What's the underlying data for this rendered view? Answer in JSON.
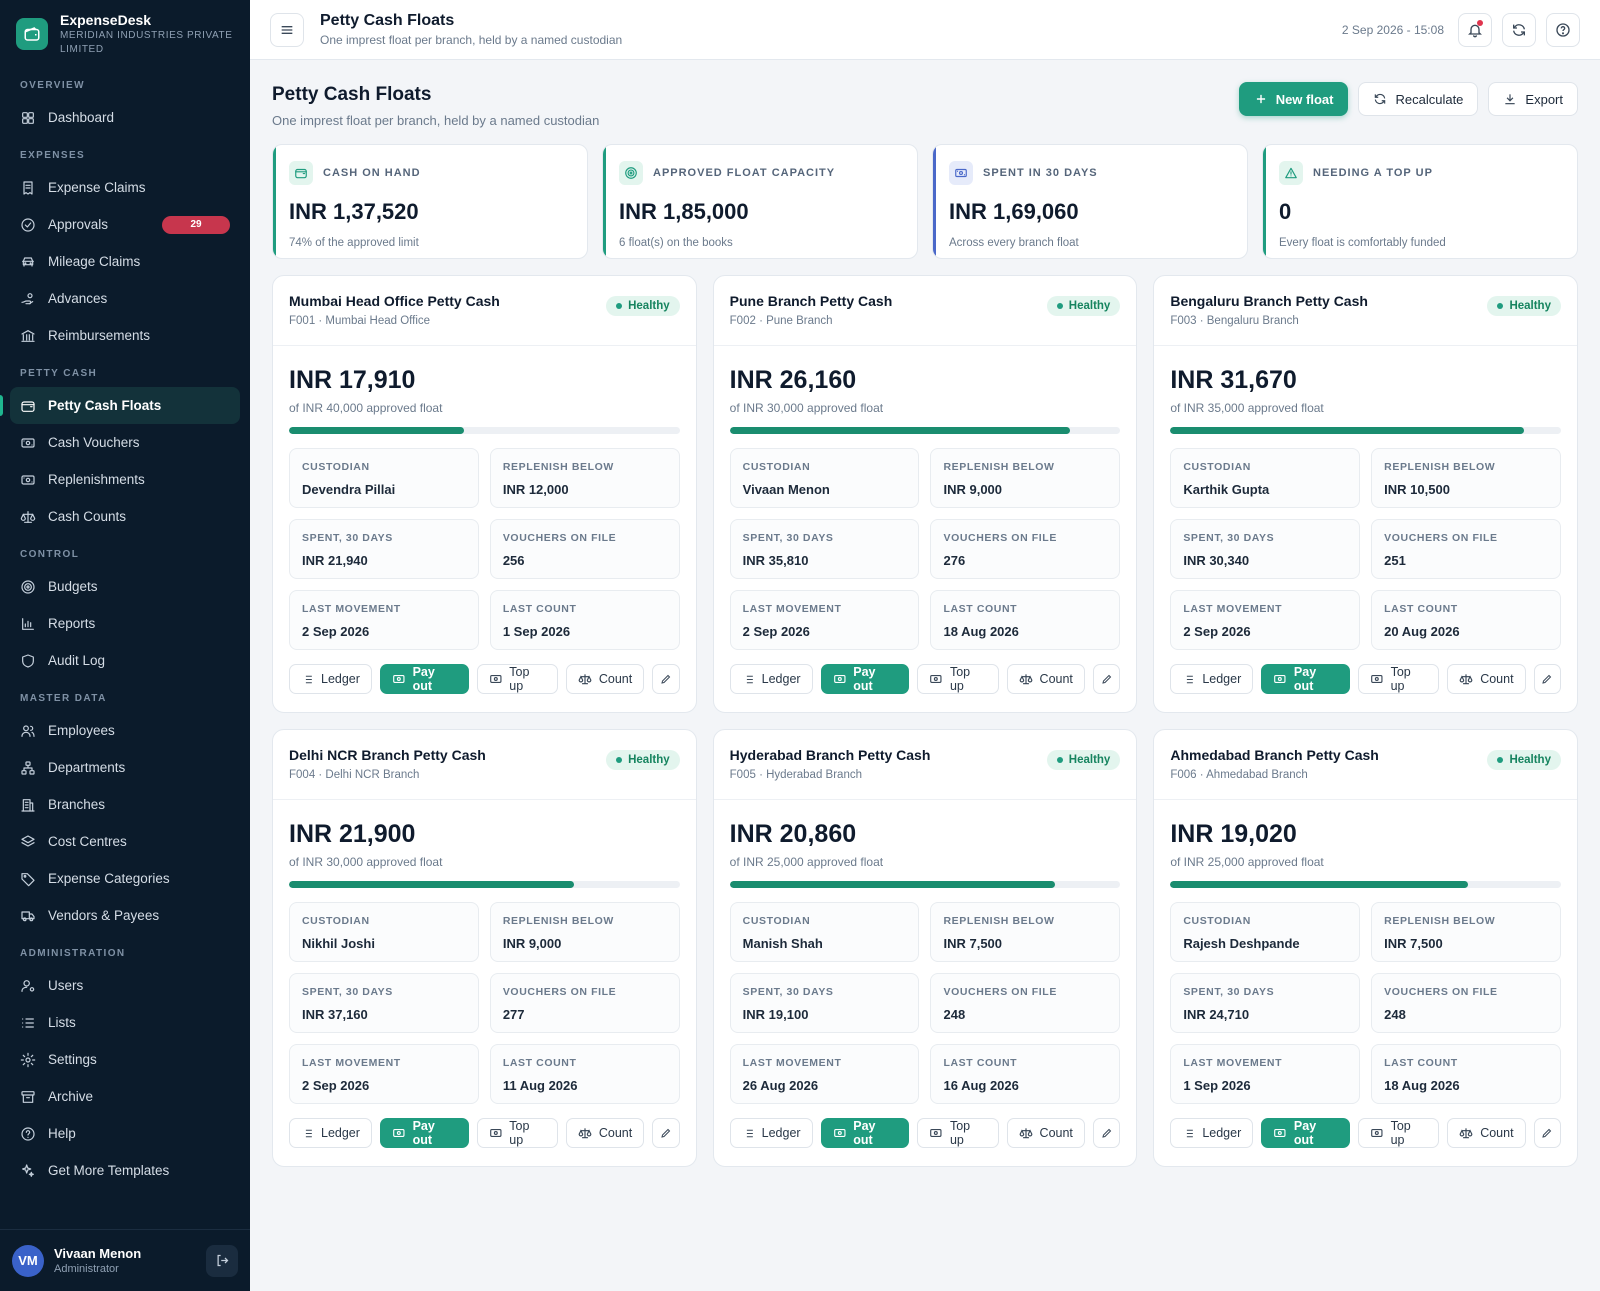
{
  "brand": {
    "name": "ExpenseDesk",
    "org": "MERIDIAN INDUSTRIES PRIVATE LIMITED",
    "accent": "#1f9c7f"
  },
  "nav": {
    "sections": [
      {
        "title": "OVERVIEW",
        "items": [
          {
            "label": "Dashboard",
            "icon": "dashboard-icon"
          }
        ]
      },
      {
        "title": "EXPENSES",
        "items": [
          {
            "label": "Expense Claims",
            "icon": "receipt-icon"
          },
          {
            "label": "Approvals",
            "icon": "check-circle-icon",
            "badge": "29"
          },
          {
            "label": "Mileage Claims",
            "icon": "car-icon"
          },
          {
            "label": "Advances",
            "icon": "hand-coin-icon"
          },
          {
            "label": "Reimbursements",
            "icon": "bank-icon"
          }
        ]
      },
      {
        "title": "PETTY CASH",
        "items": [
          {
            "label": "Petty Cash Floats",
            "icon": "wallet-icon",
            "active": true
          },
          {
            "label": "Cash Vouchers",
            "icon": "banknote-icon"
          },
          {
            "label": "Replenishments",
            "icon": "banknote-icon"
          },
          {
            "label": "Cash Counts",
            "icon": "scale-icon"
          }
        ]
      },
      {
        "title": "CONTROL",
        "items": [
          {
            "label": "Budgets",
            "icon": "target-icon"
          },
          {
            "label": "Reports",
            "icon": "bar-chart-icon"
          },
          {
            "label": "Audit Log",
            "icon": "shield-icon"
          }
        ]
      },
      {
        "title": "MASTER DATA",
        "items": [
          {
            "label": "Employees",
            "icon": "users-icon"
          },
          {
            "label": "Departments",
            "icon": "org-chart-icon"
          },
          {
            "label": "Branches",
            "icon": "building-icon"
          },
          {
            "label": "Cost Centres",
            "icon": "layers-icon"
          },
          {
            "label": "Expense Categories",
            "icon": "tag-icon"
          },
          {
            "label": "Vendors & Payees",
            "icon": "truck-icon"
          }
        ]
      },
      {
        "title": "ADMINISTRATION",
        "items": [
          {
            "label": "Users",
            "icon": "user-cog-icon"
          },
          {
            "label": "Lists",
            "icon": "list-icon"
          },
          {
            "label": "Settings",
            "icon": "gear-icon"
          },
          {
            "label": "Archive",
            "icon": "archive-icon"
          },
          {
            "label": "Help",
            "icon": "help-icon"
          },
          {
            "label": "Get More Templates",
            "icon": "sparkle-icon"
          }
        ]
      }
    ]
  },
  "user": {
    "initials": "VM",
    "name": "Vivaan Menon",
    "role": "Administrator"
  },
  "topbar": {
    "title": "Petty Cash Floats",
    "subtitle": "One imprest float per branch, held by a named custodian",
    "datetime": "2 Sep 2026 - 15:08"
  },
  "page": {
    "title": "Petty Cash Floats",
    "subtitle": "One imprest float per branch, held by a named custodian",
    "actions": {
      "new_float": "New float",
      "recalculate": "Recalculate",
      "export": "Export"
    }
  },
  "stats": [
    {
      "label": "CASH ON HAND",
      "value": "INR 1,37,520",
      "note": "74% of the approved limit",
      "icon": "wallet-icon",
      "color": "#1f9c7f"
    },
    {
      "label": "APPROVED FLOAT CAPACITY",
      "value": "INR 1,85,000",
      "note": "6 float(s) on the books",
      "icon": "target-icon",
      "color": "#1f9c7f"
    },
    {
      "label": "SPENT IN 30 DAYS",
      "value": "INR 1,69,060",
      "note": "Across every branch float",
      "icon": "banknote-icon",
      "color": "#4a68c9"
    },
    {
      "label": "NEEDING A TOP UP",
      "value": "0",
      "note": "Every float is comfortably funded",
      "icon": "alert-icon",
      "color": "#1f9c7f"
    }
  ],
  "labels": {
    "custodian": "CUSTODIAN",
    "replenish_below": "REPLENISH BELOW",
    "spent_30": "SPENT, 30 DAYS",
    "vouchers": "VOUCHERS ON FILE",
    "last_movement": "LAST MOVEMENT",
    "last_count": "LAST COUNT",
    "ledger": "Ledger",
    "pay_out": "Pay out",
    "top_up": "Top up",
    "count": "Count"
  },
  "floats": [
    {
      "name": "Mumbai Head Office Petty Cash",
      "ref": "F001 · Mumbai Head Office",
      "status": "Healthy",
      "balance": "INR 17,910",
      "limit_note": "of INR 40,000 approved float",
      "fill_pct": 44.8,
      "custodian": "Devendra Pillai",
      "replenish_below": "INR 12,000",
      "spent_30": "INR 21,940",
      "vouchers": "256",
      "last_movement": "2 Sep 2026",
      "last_count": "1 Sep 2026"
    },
    {
      "name": "Pune Branch Petty Cash",
      "ref": "F002 · Pune Branch",
      "status": "Healthy",
      "balance": "INR 26,160",
      "limit_note": "of INR 30,000 approved float",
      "fill_pct": 87.2,
      "custodian": "Vivaan Menon",
      "replenish_below": "INR 9,000",
      "spent_30": "INR 35,810",
      "vouchers": "276",
      "last_movement": "2 Sep 2026",
      "last_count": "18 Aug 2026"
    },
    {
      "name": "Bengaluru Branch Petty Cash",
      "ref": "F003 · Bengaluru Branch",
      "status": "Healthy",
      "balance": "INR 31,670",
      "limit_note": "of INR 35,000 approved float",
      "fill_pct": 90.5,
      "custodian": "Karthik Gupta",
      "replenish_below": "INR 10,500",
      "spent_30": "INR 30,340",
      "vouchers": "251",
      "last_movement": "2 Sep 2026",
      "last_count": "20 Aug 2026"
    },
    {
      "name": "Delhi NCR Branch Petty Cash",
      "ref": "F004 · Delhi NCR Branch",
      "status": "Healthy",
      "balance": "INR 21,900",
      "limit_note": "of INR 30,000 approved float",
      "fill_pct": 73,
      "custodian": "Nikhil Joshi",
      "replenish_below": "INR 9,000",
      "spent_30": "INR 37,160",
      "vouchers": "277",
      "last_movement": "2 Sep 2026",
      "last_count": "11 Aug 2026"
    },
    {
      "name": "Hyderabad Branch Petty Cash",
      "ref": "F005 · Hyderabad Branch",
      "status": "Healthy",
      "balance": "INR 20,860",
      "limit_note": "of INR 25,000 approved float",
      "fill_pct": 83.4,
      "custodian": "Manish Shah",
      "replenish_below": "INR 7,500",
      "spent_30": "INR 19,100",
      "vouchers": "248",
      "last_movement": "26 Aug 2026",
      "last_count": "16 Aug 2026"
    },
    {
      "name": "Ahmedabad Branch Petty Cash",
      "ref": "F006 · Ahmedabad Branch",
      "status": "Healthy",
      "balance": "INR 19,020",
      "limit_note": "of INR 25,000 approved float",
      "fill_pct": 76.1,
      "custodian": "Rajesh Deshpande",
      "replenish_below": "INR 7,500",
      "spent_30": "INR 24,710",
      "vouchers": "248",
      "last_movement": "1 Sep 2026",
      "last_count": "18 Aug 2026"
    }
  ]
}
